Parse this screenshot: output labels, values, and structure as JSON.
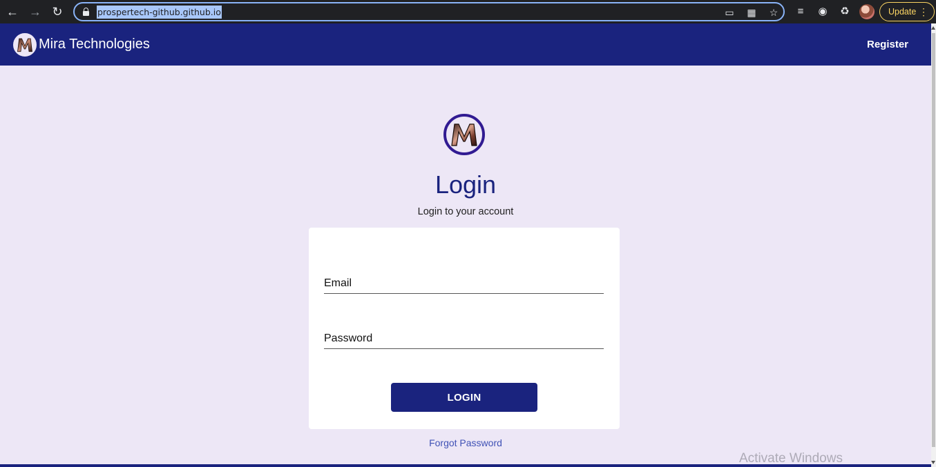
{
  "browser": {
    "url": "prospertech-github.github.io",
    "update_label": "Update",
    "icons": [
      "back-arrow-icon",
      "forward-arrow-icon",
      "reload-icon",
      "lock-icon",
      "cast-icon",
      "qr-code-icon",
      "star-icon",
      "reading-list-icon",
      "extension-globe-icon",
      "puzzle-icon",
      "profile-avatar",
      "menu-dots-icon"
    ]
  },
  "appbar": {
    "brand": "Mira Technologies",
    "register_label": "Register"
  },
  "login": {
    "title": "Login",
    "subtitle": "Login to your account",
    "email_placeholder": "Email",
    "password_placeholder": "Password",
    "button_label": "LOGIN",
    "forgot_label": "Forgot Password"
  },
  "watermark": "Activate Windows",
  "colors": {
    "primary": "#1a237e",
    "background": "#ede7f6",
    "card": "#ffffff",
    "link": "#3f51b5"
  }
}
